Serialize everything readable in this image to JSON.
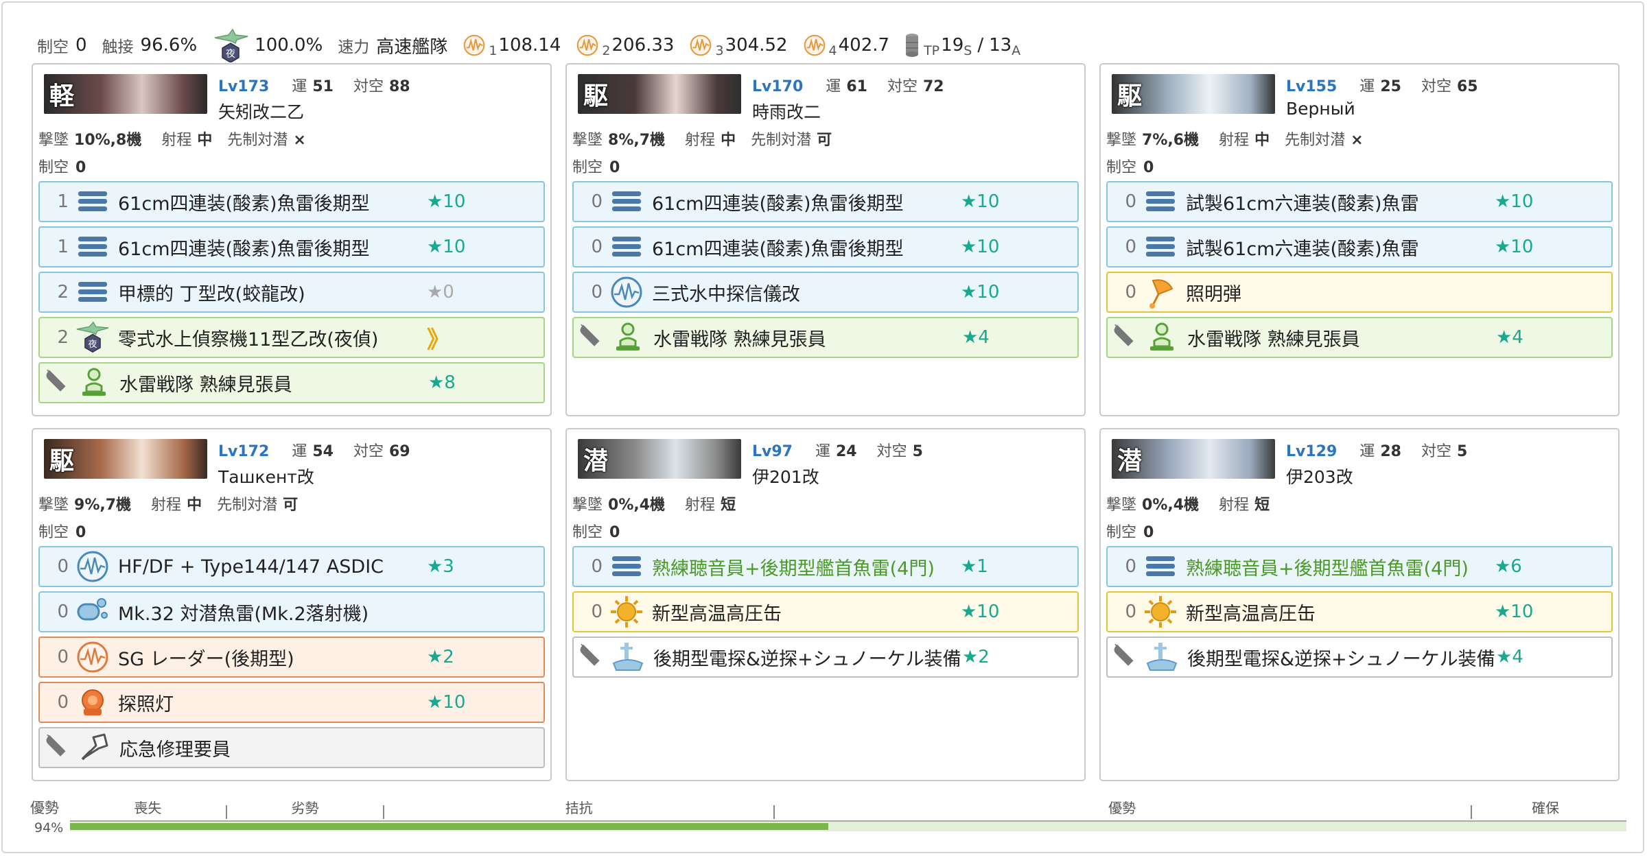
{
  "header": {
    "air_label": "制空",
    "air_value": "0",
    "contact_label": "触接",
    "contact_value": "96.6%",
    "contact_icon": "night-recon-plane-icon",
    "contact_icon_badge": "夜",
    "contact2_value": "100.0%",
    "speed_label": "速力",
    "speed_value": "高速艦隊",
    "los": [
      {
        "sub": "1",
        "value": "108.14"
      },
      {
        "sub": "2",
        "value": "206.33"
      },
      {
        "sub": "3",
        "value": "304.52"
      },
      {
        "sub": "4",
        "value": "402.7"
      }
    ],
    "tp_sub": "TP",
    "tp_s_value": "19",
    "tp_s_sub": "S",
    "tp_sep": "/",
    "tp_a_value": "13",
    "tp_a_sub": "A"
  },
  "labels": {
    "lv": "Lv",
    "luck": "運",
    "asw": "対空",
    "shotdown": "撃墜",
    "range": "射程",
    "oasw": "先制対潜",
    "air": "制空",
    "star": "★",
    "proficiency": "》"
  },
  "colors": {
    "blue": "#86c4e6",
    "green": "#a5d684",
    "yellow": "#e6c435",
    "orange": "#e08a58",
    "grey": "#bdbdbd",
    "lv": "#2a74c0",
    "star": "#19a890",
    "bar": "#7ab648"
  },
  "ships": [
    {
      "type": "軽",
      "lv": "173",
      "luck": "51",
      "aa": "88",
      "name": "矢矧改二乙",
      "shotdown": "10%,8機",
      "range": "中",
      "oasw": "×",
      "show_oasw": true,
      "air": "0",
      "slots": [
        {
          "count": "1",
          "icon": "torpedo-icon",
          "name": "61cm四連装(酸素)魚雷後期型",
          "star": "★10",
          "color": "blue"
        },
        {
          "count": "1",
          "icon": "torpedo-icon",
          "name": "61cm四連装(酸素)魚雷後期型",
          "star": "★10",
          "color": "blue"
        },
        {
          "count": "2",
          "icon": "torpedo-icon",
          "name": "甲標的 丁型改(蛟龍改)",
          "star": "★0",
          "color": "blue",
          "grey_star": true
        },
        {
          "count": "2",
          "icon": "night-recon-plane-icon",
          "name": "零式水上偵察機11型乙改(夜偵)",
          "star": "",
          "proficiency": true,
          "color": "green"
        },
        {
          "count": "",
          "icon": "lookout-icon",
          "name": "水雷戦隊 熟練見張員",
          "star": "★8",
          "color": "green",
          "ex": true
        }
      ]
    },
    {
      "type": "駆",
      "lv": "170",
      "luck": "61",
      "aa": "72",
      "name": "時雨改二",
      "shotdown": "8%,7機",
      "range": "中",
      "oasw": "可",
      "show_oasw": true,
      "air": "0",
      "slots": [
        {
          "count": "0",
          "icon": "torpedo-icon",
          "name": "61cm四連装(酸素)魚雷後期型",
          "star": "★10",
          "color": "blue"
        },
        {
          "count": "0",
          "icon": "torpedo-icon",
          "name": "61cm四連装(酸素)魚雷後期型",
          "star": "★10",
          "color": "blue"
        },
        {
          "count": "0",
          "icon": "sonar-icon",
          "name": "三式水中探信儀改",
          "star": "★10",
          "color": "blue"
        },
        {
          "count": "",
          "icon": "lookout-icon",
          "name": "水雷戦隊 熟練見張員",
          "star": "★4",
          "color": "green",
          "ex": true
        }
      ]
    },
    {
      "type": "駆",
      "lv": "155",
      "luck": "25",
      "aa": "65",
      "name": "Верный",
      "shotdown": "7%,6機",
      "range": "中",
      "oasw": "×",
      "show_oasw": true,
      "air": "0",
      "slots": [
        {
          "count": "0",
          "icon": "torpedo-icon",
          "name": "試製61cm六連装(酸素)魚雷",
          "star": "★10",
          "color": "blue"
        },
        {
          "count": "0",
          "icon": "torpedo-icon",
          "name": "試製61cm六連装(酸素)魚雷",
          "star": "★10",
          "color": "blue"
        },
        {
          "count": "0",
          "icon": "star-shell-icon",
          "name": "照明弾",
          "star": "",
          "color": "yellow"
        },
        {
          "count": "",
          "icon": "lookout-icon",
          "name": "水雷戦隊 熟練見張員",
          "star": "★4",
          "color": "green",
          "ex": true
        }
      ]
    },
    {
      "type": "駆",
      "lv": "172",
      "luck": "54",
      "aa": "69",
      "name": "Ташкент改",
      "shotdown": "9%,7機",
      "range": "中",
      "oasw": "可",
      "show_oasw": true,
      "air": "0",
      "slots": [
        {
          "count": "0",
          "icon": "sonar-icon",
          "name": "HF/DF + Type144/147 ASDIC",
          "star": "★3",
          "color": "blue"
        },
        {
          "count": "0",
          "icon": "depth-charge-icon",
          "name": "Mk.32 対潜魚雷(Mk.2落射機)",
          "star": "",
          "color": "blue"
        },
        {
          "count": "0",
          "icon": "radar-icon",
          "name": "SG レーダー(後期型)",
          "star": "★2",
          "color": "orange"
        },
        {
          "count": "0",
          "icon": "searchlight-icon",
          "name": "探照灯",
          "star": "★10",
          "color": "orange"
        },
        {
          "count": "",
          "icon": "repair-team-icon",
          "name": "応急修理要員",
          "star": "",
          "color": "grey",
          "ex": true
        }
      ]
    },
    {
      "type": "潜",
      "lv": "97",
      "luck": "24",
      "aa": "5",
      "name": "伊201改",
      "shotdown": "0%,4機",
      "range": "短",
      "oasw": "",
      "show_oasw": false,
      "air": "0",
      "slots": [
        {
          "count": "0",
          "icon": "torpedo-icon",
          "name": "熟練聴音員+後期型艦首魚雷(4門)",
          "star": "★1",
          "color": "blue",
          "green_name": true
        },
        {
          "count": "0",
          "icon": "boiler-icon",
          "name": "新型高温高圧缶",
          "star": "★10",
          "color": "yellow"
        },
        {
          "count": "",
          "icon": "submarine-radar-icon",
          "name": "後期型電探&逆探+シュノーケル装備",
          "star": "★2",
          "color": "white",
          "ex": true
        }
      ]
    },
    {
      "type": "潜",
      "lv": "129",
      "luck": "28",
      "aa": "5",
      "name": "伊203改",
      "shotdown": "0%,4機",
      "range": "短",
      "oasw": "",
      "show_oasw": false,
      "air": "0",
      "slots": [
        {
          "count": "0",
          "icon": "torpedo-icon",
          "name": "熟練聴音員+後期型艦首魚雷(4門)",
          "star": "★6",
          "color": "blue",
          "green_name": true
        },
        {
          "count": "0",
          "icon": "boiler-icon",
          "name": "新型高温高圧缶",
          "star": "★10",
          "color": "yellow"
        },
        {
          "count": "",
          "icon": "submarine-radar-icon",
          "name": "後期型電探&逆探+シュノーケル装備",
          "star": "★4",
          "color": "white",
          "ex": true
        }
      ]
    }
  ],
  "air_bar": {
    "state": "優勢",
    "percent": "94%",
    "fill": 0.487,
    "zones": [
      {
        "label": "喪失",
        "center": 0.05
      },
      {
        "label": "劣勢",
        "center": 0.151
      },
      {
        "label": "拮抗",
        "center": 0.327
      },
      {
        "label": "優勢",
        "center": 0.676
      },
      {
        "label": "確保",
        "center": 0.948
      }
    ],
    "ticks": [
      0.1,
      0.201,
      0.452,
      0.9
    ]
  }
}
